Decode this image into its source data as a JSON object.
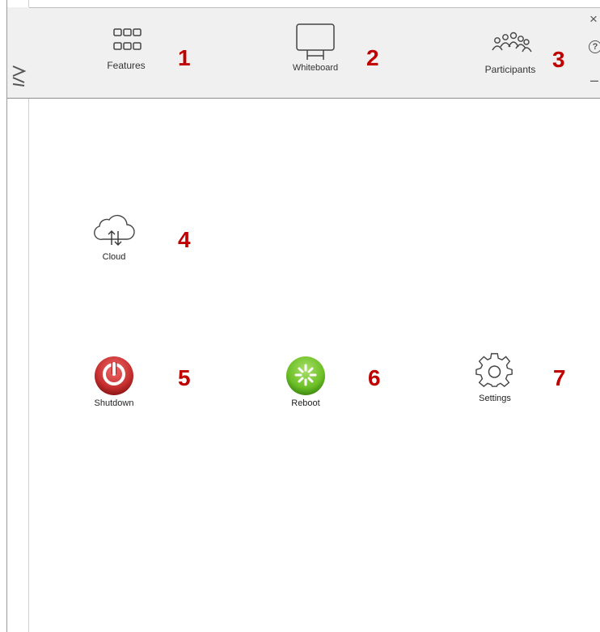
{
  "toolbar": {
    "features_label": "Features",
    "whiteboard_label": "Whiteboard",
    "participants_label": "Participants"
  },
  "window_controls": {
    "close": "×",
    "help": "?",
    "minimize": "–"
  },
  "apps": {
    "cloud_label": "Cloud",
    "shutdown_label": "Shutdown",
    "reboot_label": "Reboot",
    "settings_label": "Settings"
  },
  "callouts": [
    "1",
    "2",
    "3",
    "4",
    "5",
    "6",
    "7"
  ],
  "colors": {
    "callout": "#c00000",
    "shutdown": "#c62f2f",
    "reboot": "#6cbf26",
    "toolbar_bg": "#f0f0f0"
  }
}
